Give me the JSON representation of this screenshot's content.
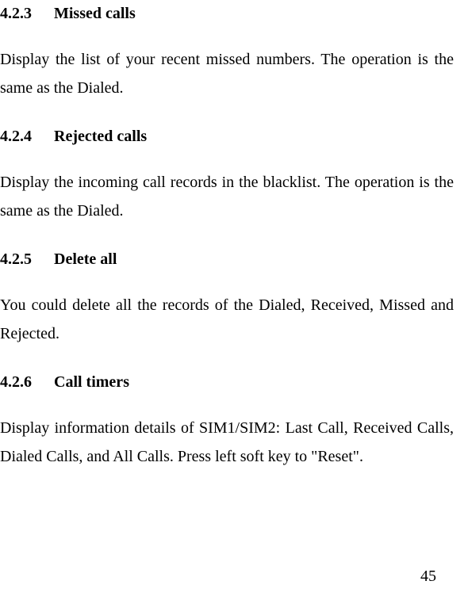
{
  "sections": [
    {
      "number": "4.2.3",
      "title": "Missed calls",
      "body": "Display the list of your recent missed numbers. The operation is the same as the Dialed."
    },
    {
      "number": "4.2.4",
      "title": "Rejected calls",
      "body": "Display the incoming call records in the blacklist. The operation is the same as the Dialed."
    },
    {
      "number": "4.2.5",
      "title": "Delete all",
      "body": "You could delete all the records of the Dialed, Received, Missed and Rejected."
    },
    {
      "number": "4.2.6",
      "title": "Call timers",
      "body": "Display information details of SIM1/SIM2: Last Call, Received Calls, Dialed Calls, and All Calls. Press left soft key to \"Reset\"."
    }
  ],
  "pageNumber": "45"
}
